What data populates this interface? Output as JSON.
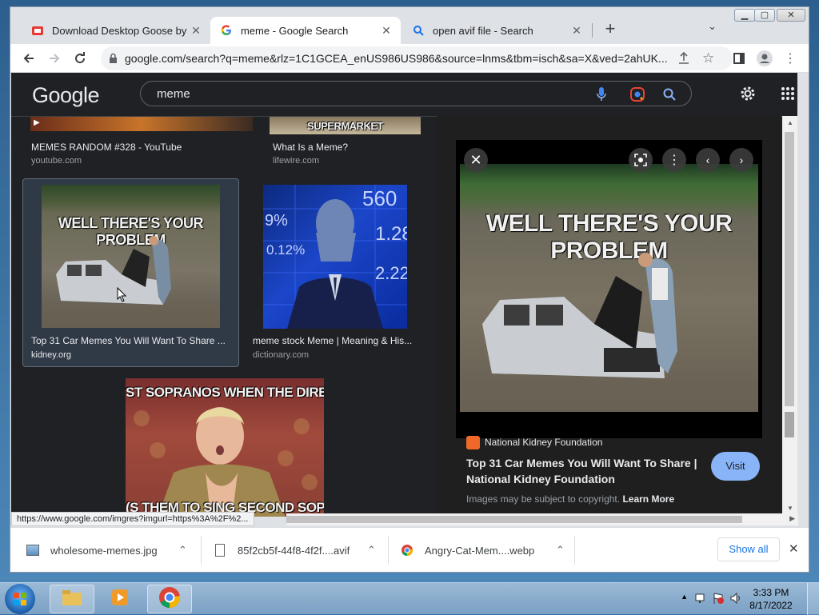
{
  "browser": {
    "tabs": [
      {
        "title": "Download Desktop Goose by sam",
        "icon": "goose-site-icon"
      },
      {
        "title": "meme - Google Search",
        "icon": "google-icon"
      },
      {
        "title": "open avif file - Search",
        "icon": "search-icon"
      }
    ],
    "new_tab": "+",
    "url_host": "google.com",
    "url_rest": "/search?q=meme&rlz=1C1GCEA_enUS986US986&source=lnms&tbm=isch&sa=X&ved=2ahUK..."
  },
  "google": {
    "logo": "Google",
    "query": "meme"
  },
  "results": [
    {
      "title": "MEMES RANDOM #328 - YouTube",
      "source": "youtube.com"
    },
    {
      "title": "What Is a Meme?",
      "source": "lifewire.com",
      "thumb_text": "SUPERMARKET"
    },
    {
      "title": "Top 31 Car Memes You Will Want To Share ...",
      "source": "kidney.org",
      "thumb_text": "WELL THERE'S YOUR PROBLEM"
    },
    {
      "title": "meme stock Meme | Meaning & His...",
      "source": "dictionary.com",
      "thumb_text": [
        "560",
        "9%",
        "1.28",
        "0.12%",
        "2.22"
      ]
    },
    {
      "thumb_text_top": "ST SOPRANOS WHEN THE DIRECT",
      "thumb_text_bottom": "(S THEM TO SING SECOND SOPRA"
    }
  ],
  "preview": {
    "image_text": "WELL THERE'S YOUR PROBLEM",
    "source": "National Kidney Foundation",
    "title": "Top 31 Car Memes You Will Want To Share | National Kidney Foundation",
    "visit": "Visit",
    "copyright": "Images may be subject to copyright.",
    "learn_more": "Learn More"
  },
  "status_url": "https://www.google.com/imgres?imgurl=https%3A%2F%2...",
  "downloads": [
    {
      "name": "wholesome-memes.jpg"
    },
    {
      "name": "85f2cb5f-44f8-4f2f....avif"
    },
    {
      "name": "Angry-Cat-Mem....webp"
    }
  ],
  "show_all": "Show all",
  "clock": {
    "time": "3:33 PM",
    "date": "8/17/2022"
  }
}
